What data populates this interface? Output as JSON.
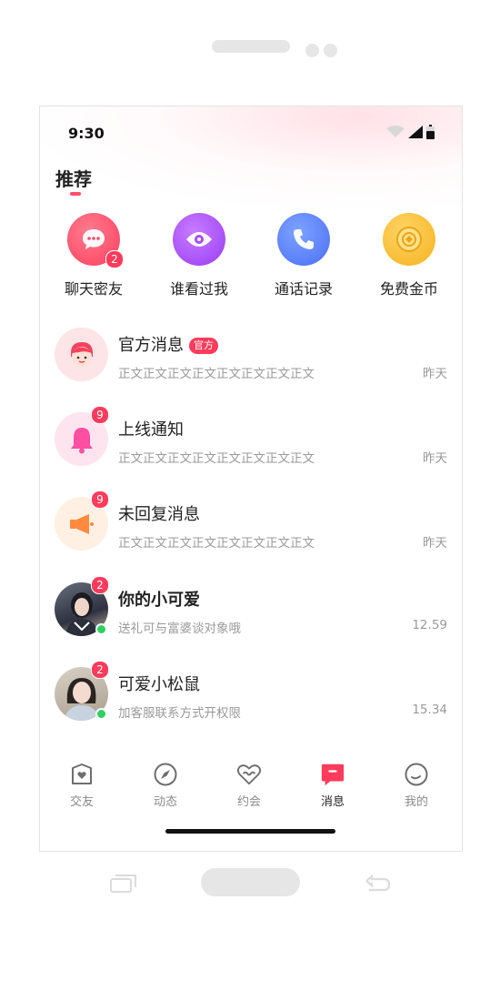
{
  "status_bar": {
    "time": "9:30"
  },
  "header": {
    "title": "推荐"
  },
  "quick_actions": [
    {
      "label": "聊天密友",
      "icon": "chat-bubble-icon",
      "color": "#ff4d6d",
      "badge": "2"
    },
    {
      "label": "谁看过我",
      "icon": "eye-icon",
      "color": "#a64dff",
      "badge": ""
    },
    {
      "label": "通话记录",
      "icon": "phone-icon",
      "color": "#4f7bff",
      "badge": ""
    },
    {
      "label": "免费金币",
      "icon": "coin-icon",
      "color": "#ffc23d",
      "badge": ""
    }
  ],
  "messages": [
    {
      "name": "官方消息",
      "tag": "官方",
      "preview": "正文正文正文正文正文正文正文正文",
      "time": "昨天",
      "badge": "",
      "avatar": "official-avatar-icon"
    },
    {
      "name": "上线通知",
      "tag": "",
      "preview": "正文正文正文正文正文正文正文正文",
      "time": "昨天",
      "badge": "9",
      "avatar": "bell-icon"
    },
    {
      "name": "未回复消息",
      "tag": "",
      "preview": "正文正文正文正文正文正文正文正文",
      "time": "昨天",
      "badge": "9",
      "avatar": "megaphone-icon"
    },
    {
      "name": "你的小可爱",
      "tag": "",
      "preview": "送礼可与富婆谈对象哦",
      "time": "12.59",
      "badge": "2",
      "avatar": "user-photo"
    },
    {
      "name": "可爱小松鼠",
      "tag": "",
      "preview": "加客服联系方式开权限",
      "time": "15.34",
      "badge": "2",
      "avatar": "user-photo"
    }
  ],
  "bottom_nav": [
    {
      "label": "交友",
      "icon": "heart-shield-icon",
      "active": false
    },
    {
      "label": "动态",
      "icon": "compass-icon",
      "active": false
    },
    {
      "label": "约会",
      "icon": "heart-wave-icon",
      "active": false
    },
    {
      "label": "消息",
      "icon": "message-icon",
      "active": true
    },
    {
      "label": "我的",
      "icon": "profile-circle-icon",
      "active": false
    }
  ],
  "colors": {
    "accent": "#ff3b5c",
    "online": "#2fd060"
  }
}
